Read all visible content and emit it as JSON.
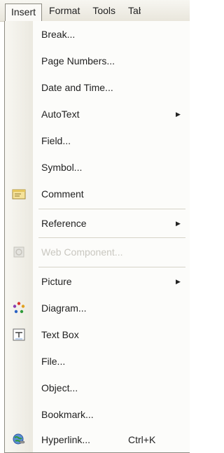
{
  "menubar": {
    "items": [
      {
        "label": "Insert",
        "active": true
      },
      {
        "label": "Format",
        "active": false
      },
      {
        "label": "Tools",
        "active": false
      },
      {
        "label": "Tab",
        "active": false
      }
    ]
  },
  "menu": {
    "items": [
      {
        "label": "Break...",
        "icon": "",
        "submenu": false,
        "disabled": false,
        "shortcut": ""
      },
      {
        "label": "Page Numbers...",
        "icon": "",
        "submenu": false,
        "disabled": false,
        "shortcut": ""
      },
      {
        "label": "Date and Time...",
        "icon": "",
        "submenu": false,
        "disabled": false,
        "shortcut": ""
      },
      {
        "label": "AutoText",
        "icon": "",
        "submenu": true,
        "disabled": false,
        "shortcut": ""
      },
      {
        "label": "Field...",
        "icon": "",
        "submenu": false,
        "disabled": false,
        "shortcut": ""
      },
      {
        "label": "Symbol...",
        "icon": "",
        "submenu": false,
        "disabled": false,
        "shortcut": ""
      },
      {
        "label": "Comment",
        "icon": "comment-icon",
        "submenu": false,
        "disabled": false,
        "shortcut": ""
      },
      {
        "label": "Reference",
        "icon": "",
        "submenu": true,
        "disabled": false,
        "shortcut": ""
      },
      {
        "label": "Web Component...",
        "icon": "web-component-icon",
        "submenu": false,
        "disabled": true,
        "shortcut": ""
      },
      {
        "label": "Picture",
        "icon": "",
        "submenu": true,
        "disabled": false,
        "shortcut": ""
      },
      {
        "label": "Diagram...",
        "icon": "diagram-icon",
        "submenu": false,
        "disabled": false,
        "shortcut": ""
      },
      {
        "label": "Text Box",
        "icon": "text-box-icon",
        "submenu": false,
        "disabled": false,
        "shortcut": ""
      },
      {
        "label": "File...",
        "icon": "",
        "submenu": false,
        "disabled": false,
        "shortcut": ""
      },
      {
        "label": "Object...",
        "icon": "",
        "submenu": false,
        "disabled": false,
        "shortcut": ""
      },
      {
        "label": "Bookmark...",
        "icon": "",
        "submenu": false,
        "disabled": false,
        "shortcut": ""
      },
      {
        "label": "Hyperlink...",
        "icon": "hyperlink-icon",
        "submenu": false,
        "disabled": false,
        "shortcut": "Ctrl+K"
      }
    ],
    "arrow_glyph": "▶"
  }
}
